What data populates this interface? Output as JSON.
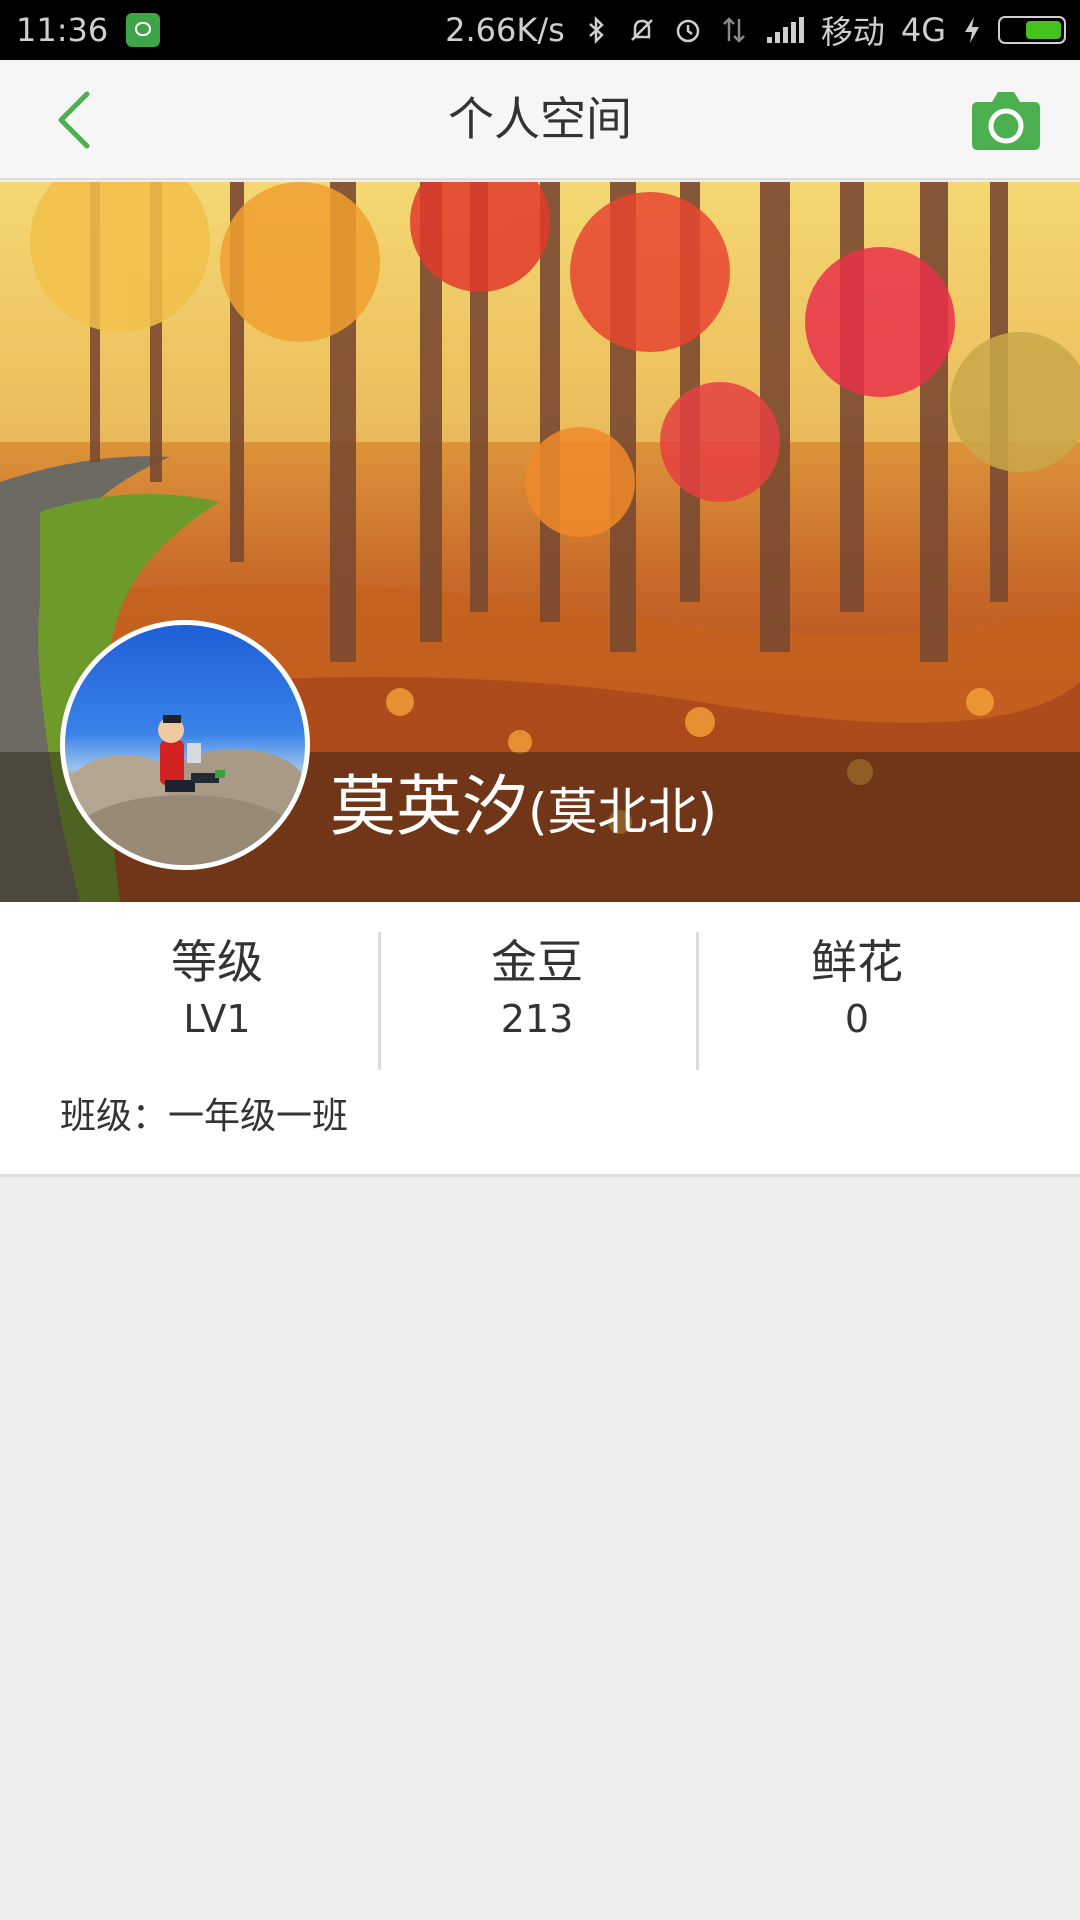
{
  "status_bar": {
    "time": "11:36",
    "net_speed": "2.66K/s",
    "carrier": "移动",
    "network": "4G",
    "icons": [
      "app-icon",
      "bluetooth-icon",
      "mute-icon",
      "alarm-icon",
      "data-icon",
      "signal-icon",
      "charging-icon",
      "battery-icon"
    ],
    "battery_level": 0.6
  },
  "nav": {
    "title": "个人空间",
    "back_icon": "chevron-left-icon",
    "camera_icon": "camera-icon",
    "accent_color": "#4caf50"
  },
  "profile": {
    "name": "莫英汐",
    "nickname": "(莫北北)"
  },
  "stats": [
    {
      "label": "等级",
      "value": "LV1"
    },
    {
      "label": "金豆",
      "value": "213"
    },
    {
      "label": "鲜花",
      "value": "0"
    }
  ],
  "class_info": "班级：一年级一班"
}
